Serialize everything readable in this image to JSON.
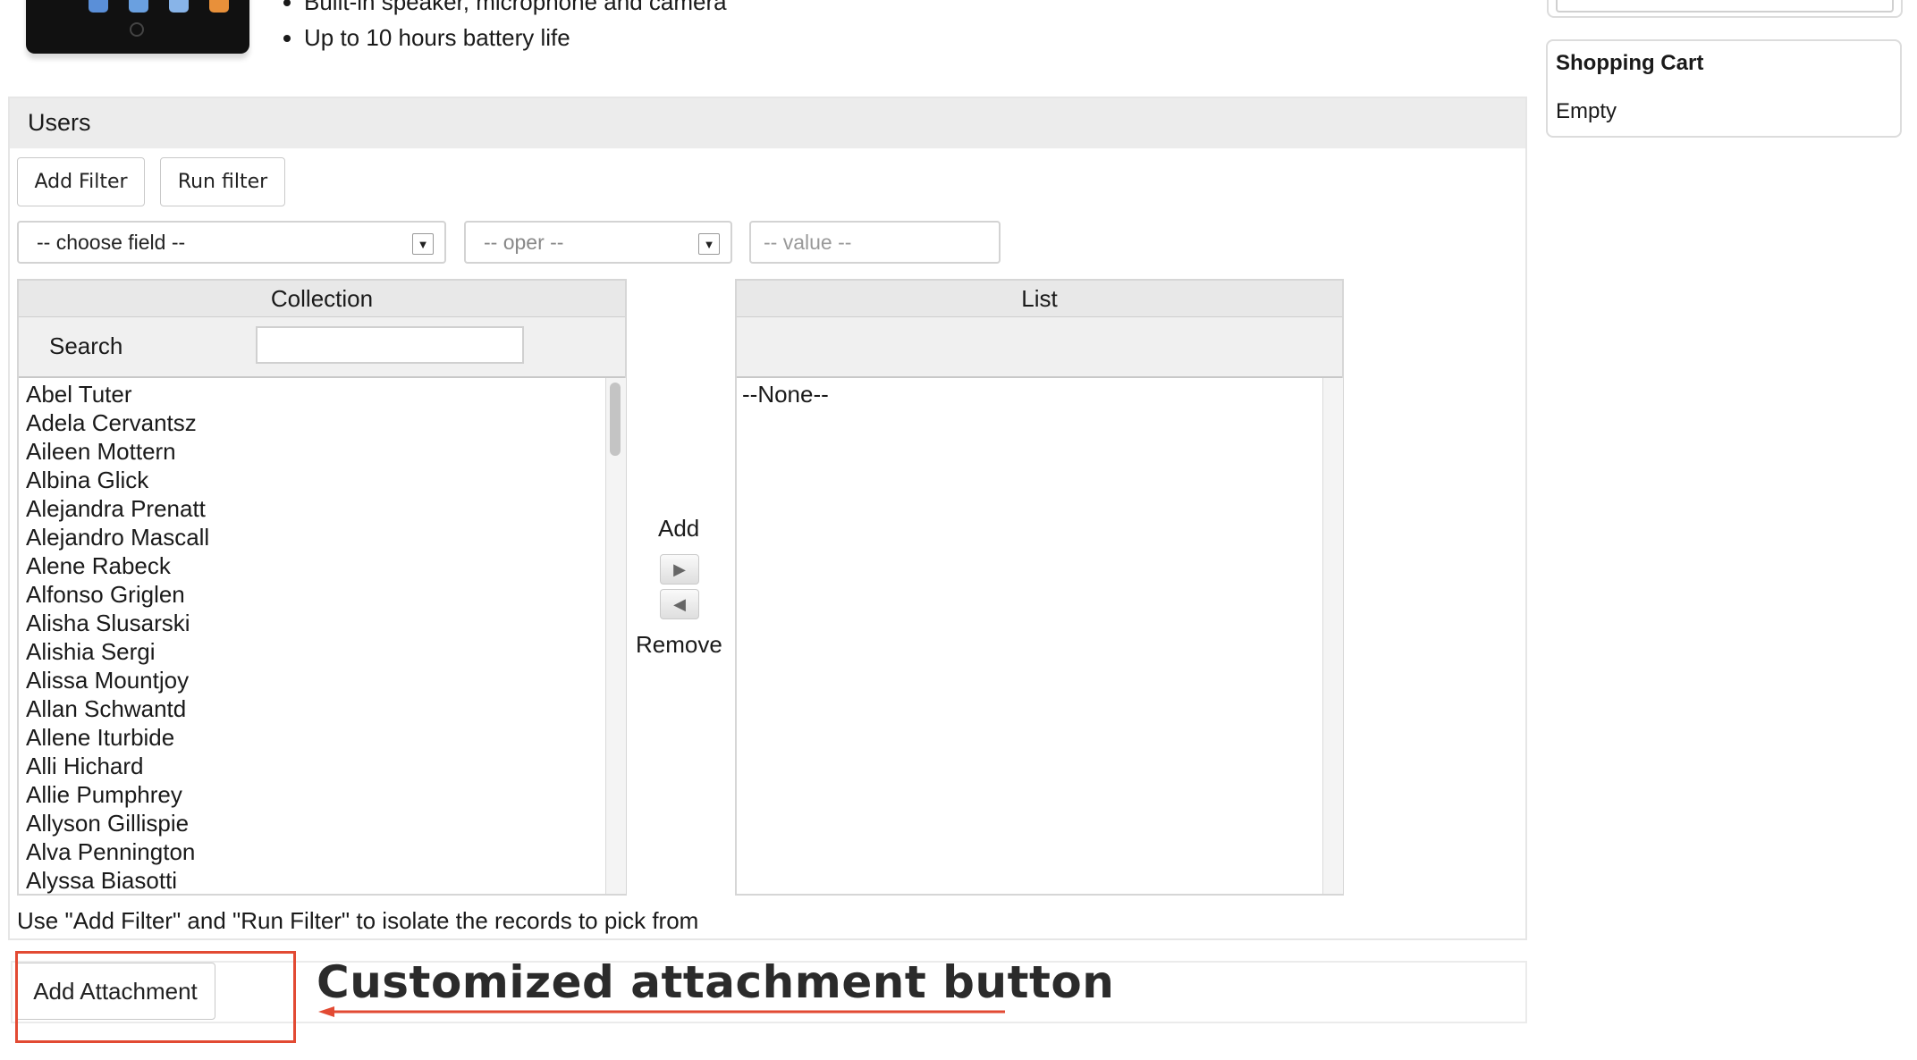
{
  "product": {
    "features": [
      "Built-in speaker, microphone and camera",
      "Up to 10 hours battery life"
    ]
  },
  "users_panel": {
    "title": "Users",
    "add_filter_label": "Add Filter",
    "run_filter_label": "Run filter",
    "field_select": "-- choose field --",
    "oper_select": "-- oper --",
    "value_placeholder": "-- value --",
    "collection": {
      "header": "Collection",
      "search_label": "Search",
      "search_value": "",
      "items": [
        "Abel Tuter",
        "Adela Cervantsz",
        "Aileen Mottern",
        "Albina Glick",
        "Alejandra Prenatt",
        "Alejandro Mascall",
        "Alene Rabeck",
        "Alfonso Griglen",
        "Alisha Slusarski",
        "Alishia Sergi",
        "Alissa Mountjoy",
        "Allan Schwantd",
        "Allene Iturbide",
        "Alli Hichard",
        "Allie Pumphrey",
        "Allyson Gillispie",
        "Alva Pennington",
        "Alyssa Biasotti"
      ]
    },
    "add_label": "Add",
    "remove_label": "Remove",
    "list": {
      "header": "List",
      "items": [
        "--None--"
      ]
    },
    "hint": "Use \"Add Filter\" and \"Run Filter\" to isolate the records to pick from"
  },
  "attachment": {
    "button_label": "Add Attachment",
    "annotation": "Customized attachment button",
    "annotation_color": "#e24a33"
  },
  "sidebar": {
    "cart_title": "Shopping Cart",
    "cart_status": "Empty"
  },
  "icons": {
    "select_arrow": "dropdown-arrow-icon",
    "move_right": "arrow-right-icon",
    "move_left": "arrow-left-icon"
  }
}
